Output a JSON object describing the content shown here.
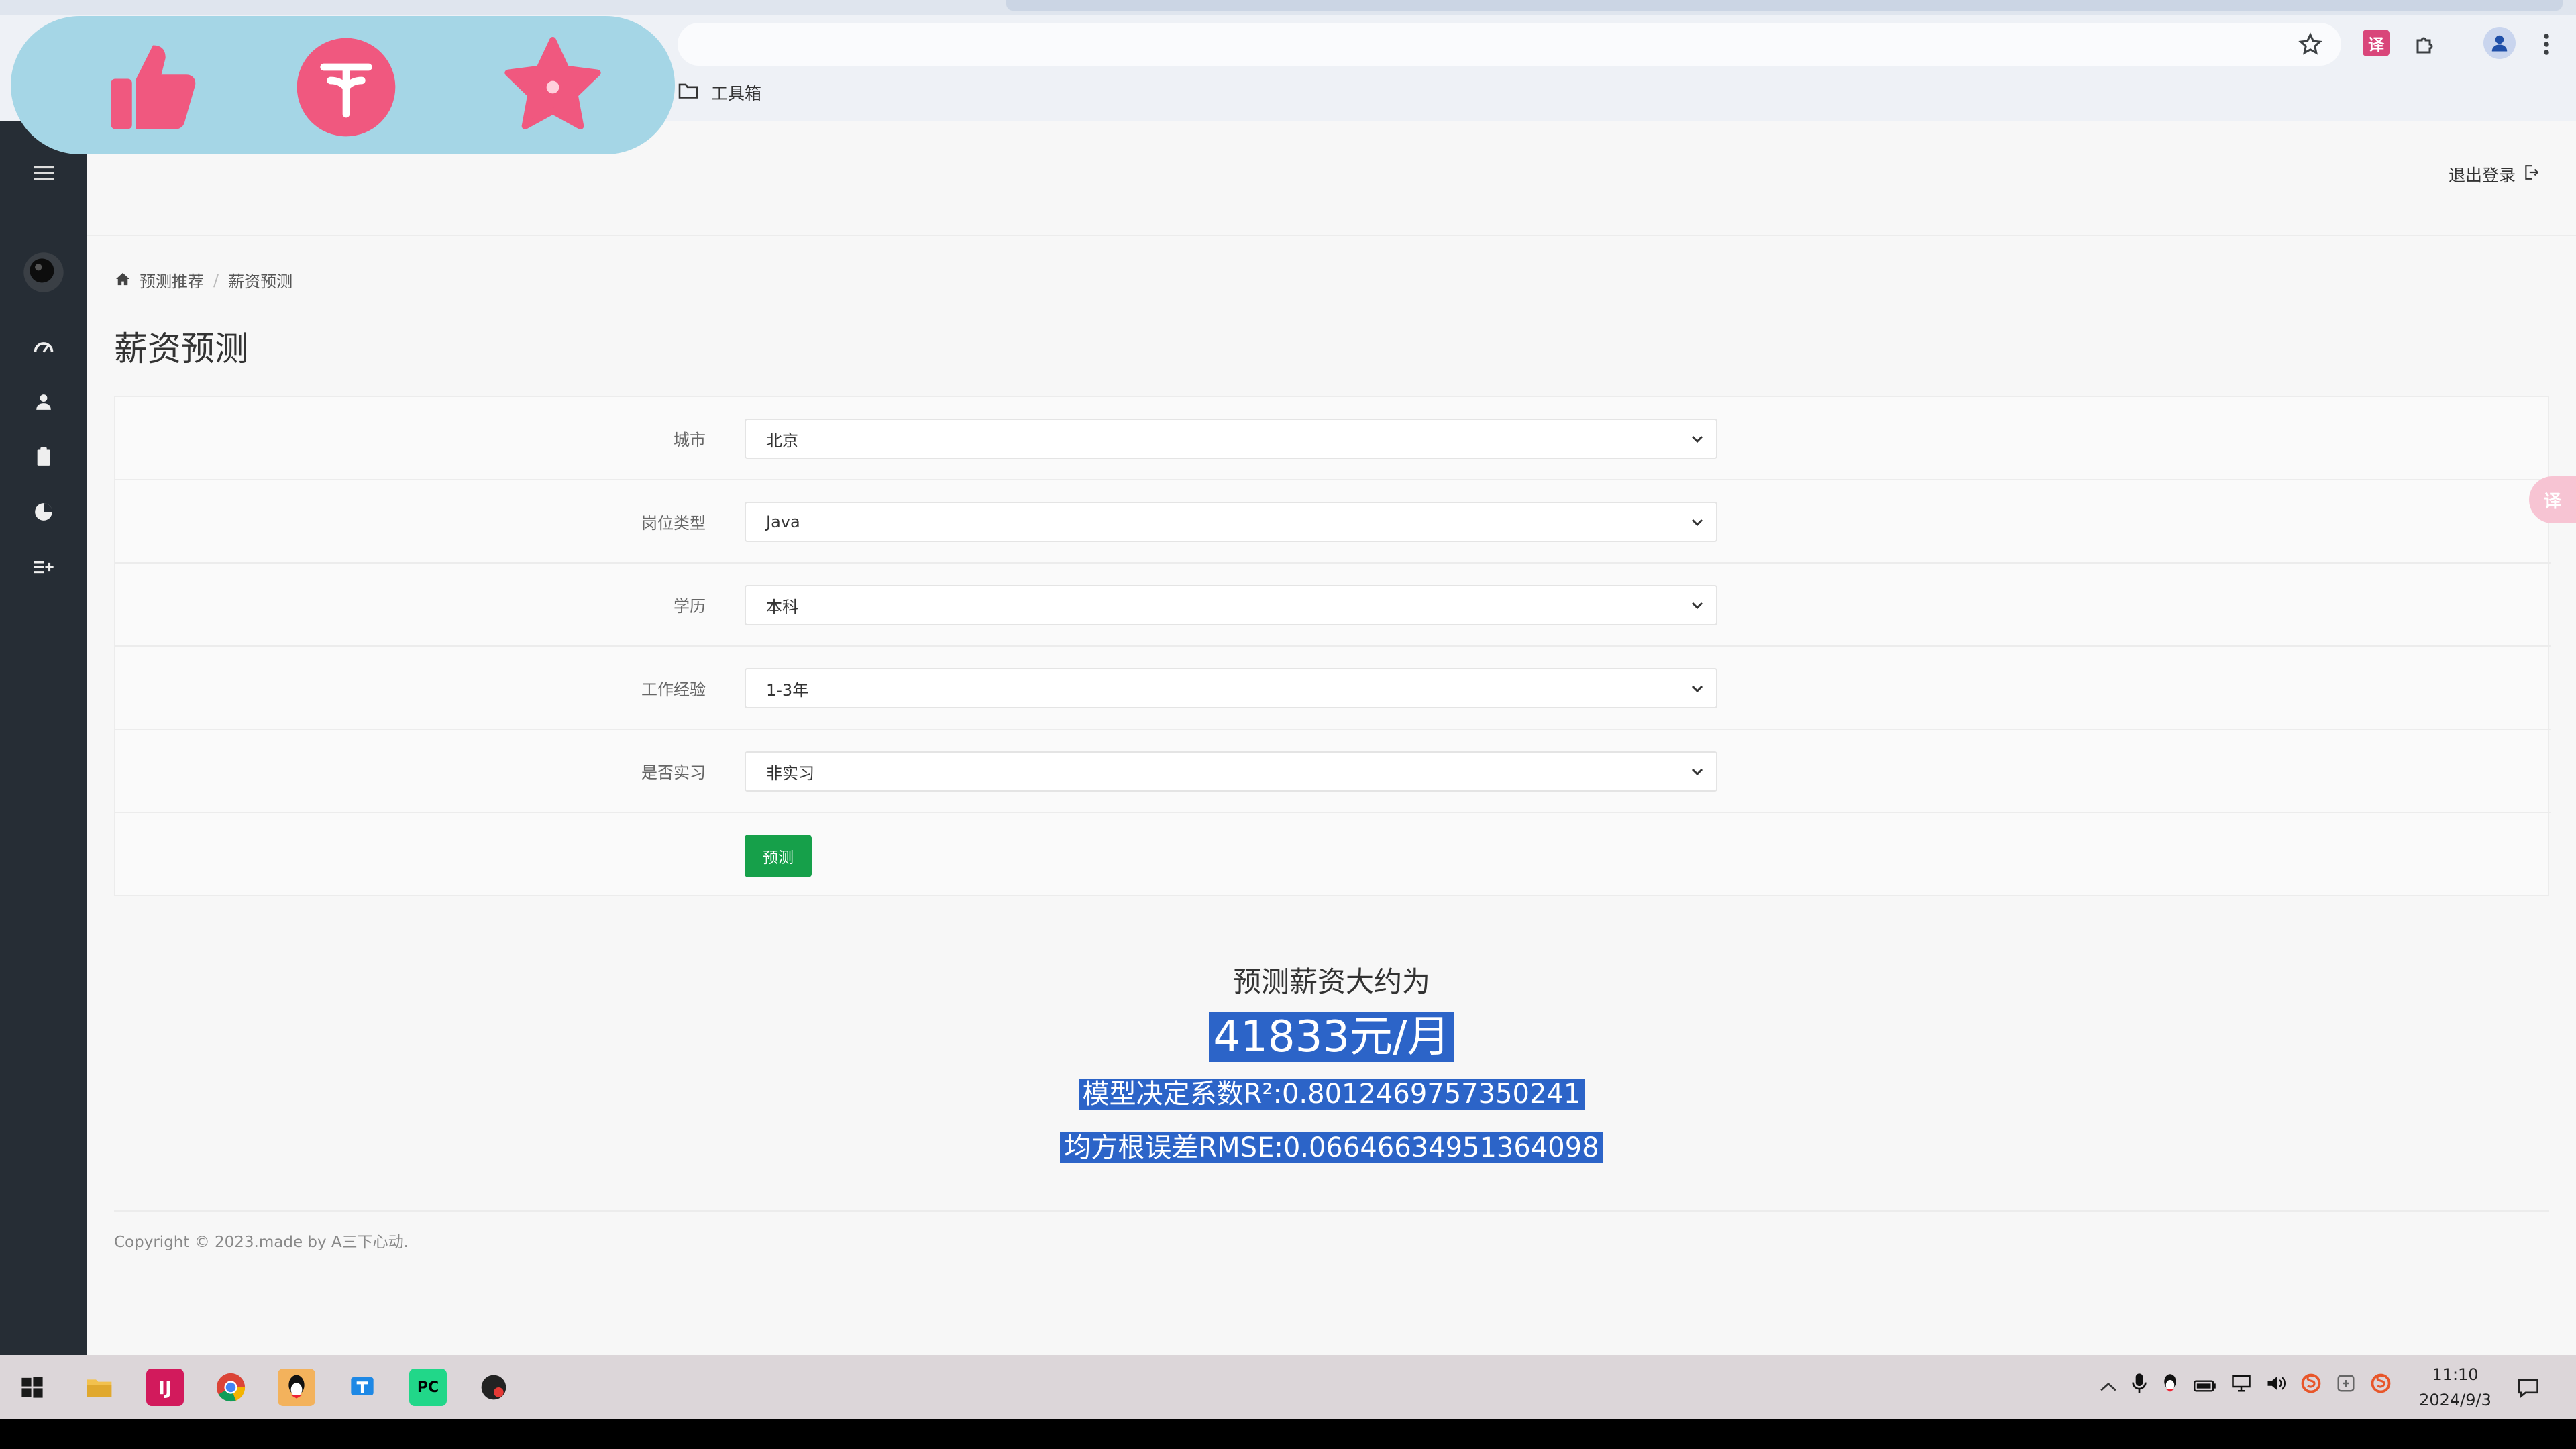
{
  "browser": {
    "bookmark": {
      "label": "工具箱",
      "icon": "folder-icon"
    },
    "toolbar_icons": [
      "star-icon",
      "translate-extension-icon",
      "puzzle-icon",
      "profile-icon",
      "more-vert-icon"
    ]
  },
  "action_bar": {
    "buttons": [
      "thumbs-up-icon",
      "coin-icon",
      "star-icon"
    ],
    "color": "#f0587f",
    "background": "#a5d6e6"
  },
  "sidebar": {
    "items": [
      "menu-icon",
      "avatar",
      "dashboard-icon",
      "user-icon",
      "clipboard-icon",
      "pie-chart-icon",
      "list-add-icon"
    ]
  },
  "header": {
    "logout_label": "退出登录"
  },
  "breadcrumb": {
    "home": "预测推荐",
    "sep": "/",
    "current": "薪资预测"
  },
  "page": {
    "title": "薪资预测"
  },
  "form": {
    "fields": [
      {
        "label": "城市",
        "value": "北京"
      },
      {
        "label": "岗位类型",
        "value": "Java"
      },
      {
        "label": "学历",
        "value": "本科"
      },
      {
        "label": "工作经验",
        "value": "1-3年"
      },
      {
        "label": "是否实习",
        "value": "非实习"
      }
    ],
    "submit_label": "预测"
  },
  "result": {
    "heading": "预测薪资大约为",
    "salary": "41833元/月",
    "r2": "模型决定系数R²:0.8012469757350241",
    "rmse": "均方根误差RMSE:0.06646634951364098"
  },
  "footer": {
    "copyright": "Copyright © 2023.made by A三下心动."
  },
  "taskbar": {
    "time": "11:10",
    "date": "2024/9/3"
  },
  "colors": {
    "sidebar": "#262d35",
    "accent_green": "#16a04a",
    "highlight": "#2c64c8"
  }
}
